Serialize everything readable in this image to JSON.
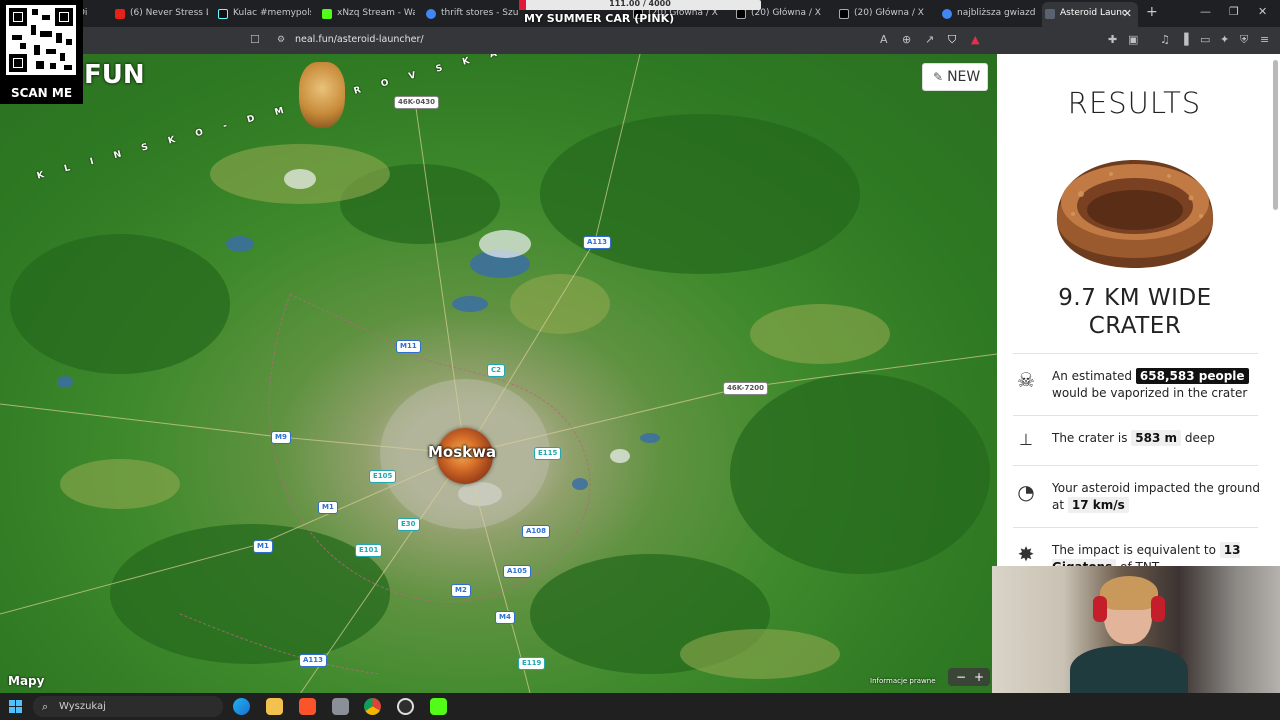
{
  "browser": {
    "tabs": [
      {
        "label": "Di",
        "color": "#888888"
      },
      {
        "label": "(6) Never Stress Lov",
        "color": "#e62117"
      },
      {
        "label": "Kulac #memypolsk",
        "color": "#111111"
      },
      {
        "label": "xNzq Stream - Watc",
        "color": "#53fc18"
      },
      {
        "label": "thrift stores - Szuka",
        "color": "#4285f4"
      },
      {
        "label": "(20) Główna / X",
        "color": "#000000"
      },
      {
        "label": "(20) Główna / X",
        "color": "#000000"
      },
      {
        "label": "(20) Główna / X",
        "color": "#000000"
      },
      {
        "label": "najbliższa gwiazda o",
        "color": "#4285f4"
      },
      {
        "label": "Asteroid Launc",
        "color": "#5a6270"
      }
    ],
    "url": "neal.fun/asteroid-launcher/"
  },
  "stream": {
    "qr_label": "SCAN ME",
    "fun_text": "FUN",
    "progress_text": "111.00 / 4000",
    "progress_fraction": 0.03,
    "game_text": "MY SUMMER CAR (PINK)"
  },
  "map": {
    "new_label": "NEW",
    "city": "Moskwa",
    "road_label_top": "K L I N S K O - D M I T R O V S K A Y A   G R Y A D A",
    "brand": "Mapy",
    "legal": "Informacje prawne",
    "road_badges": [
      {
        "label": "46K-0430",
        "style": "gray"
      },
      {
        "label": "A113",
        "style": "blue"
      },
      {
        "label": "M11",
        "style": "blue"
      },
      {
        "label": "C2",
        "style": "teal"
      },
      {
        "label": "46K-7200",
        "style": "gray"
      },
      {
        "label": "M9",
        "style": "blue"
      },
      {
        "label": "E115",
        "style": "teal"
      },
      {
        "label": "E105",
        "style": "teal"
      },
      {
        "label": "M1",
        "style": "blue"
      },
      {
        "label": "E30",
        "style": "teal"
      },
      {
        "label": "A108",
        "style": "blue"
      },
      {
        "label": "M1",
        "style": "blue"
      },
      {
        "label": "E101",
        "style": "teal"
      },
      {
        "label": "A105",
        "style": "blue"
      },
      {
        "label": "M2",
        "style": "blue"
      },
      {
        "label": "M4",
        "style": "blue"
      },
      {
        "label": "A113",
        "style": "blue"
      },
      {
        "label": "E119",
        "style": "teal"
      }
    ]
  },
  "results": {
    "title": "RESULTS",
    "crater_line1": "9.7 KM WIDE",
    "crater_line2": "CRATER",
    "stat1_pre": "An estimated",
    "stat1_value": "658,583 people",
    "stat1_post": "would be vaporized in the crater",
    "stat2_pre": "The crater is",
    "stat2_value": "583 m",
    "stat2_post": "deep",
    "stat3_pre": "Your asteroid impacted the ground at",
    "stat3_value": "17 km/s",
    "stat4_pre": "The impact is equivalent to",
    "stat4_value": "13 Gigatons",
    "stat4_post": "of TNT"
  },
  "taskbar": {
    "search_placeholder": "Wyszukaj"
  }
}
